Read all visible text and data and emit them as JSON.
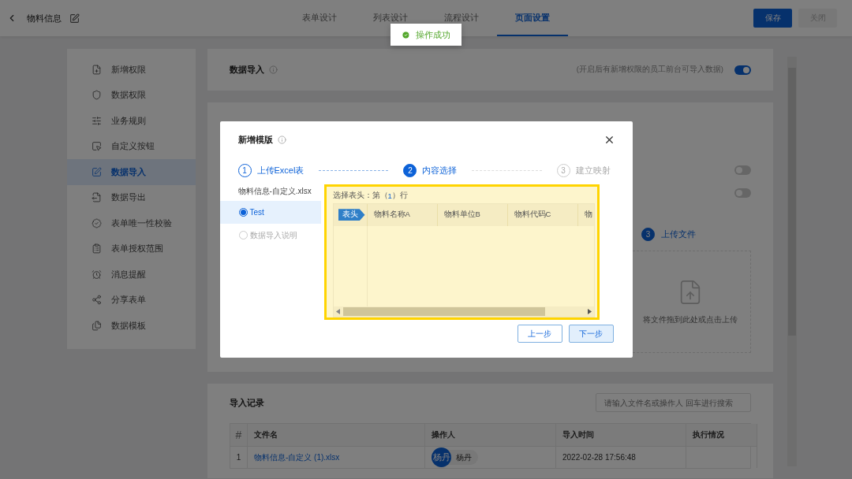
{
  "header": {
    "title": "物料信息",
    "tabs": [
      {
        "label": "表单设计",
        "selected": false
      },
      {
        "label": "列表设计",
        "selected": false
      },
      {
        "label": "流程设计",
        "selected": false
      },
      {
        "label": "页面设置",
        "selected": true
      }
    ],
    "buttons": [
      {
        "label": "保存",
        "kind": "primary"
      },
      {
        "label": "关闭",
        "kind": "disabled"
      }
    ]
  },
  "toast": {
    "text": "操作成功"
  },
  "sidebar": {
    "items": [
      {
        "label": "新增权限",
        "selected": false
      },
      {
        "label": "数据权限",
        "selected": false
      },
      {
        "label": "业务规则",
        "selected": false
      },
      {
        "label": "自定义按钮",
        "selected": false
      },
      {
        "label": "数据导入",
        "selected": true
      },
      {
        "label": "数据导出",
        "selected": false
      },
      {
        "label": "表单唯一性校验",
        "selected": false
      },
      {
        "label": "表单授权范围",
        "selected": false
      },
      {
        "label": "消息提醒",
        "selected": false
      },
      {
        "label": "分享表单",
        "selected": false
      },
      {
        "label": "数据模板",
        "selected": false
      }
    ]
  },
  "data_import": {
    "title": "数据导入",
    "hint": "(开启后有新增权限的员工前台可导入数据)",
    "on": true
  },
  "import_status": {
    "toggles": [
      {
        "on": false
      },
      {
        "on": false
      }
    ],
    "step": {
      "number": "3",
      "label": "上传文件"
    },
    "upload_hint": "将文件拖到此处或点击上传"
  },
  "records": {
    "title": "导入记录",
    "search": {
      "placeholder": "请输入文件名或操作人 回车进行搜索"
    },
    "columns": [
      "#",
      "文件名",
      "操作人",
      "导入时间",
      "执行情况"
    ],
    "rows": [
      {
        "index": "1",
        "file": "物料信息-自定义 (1).xlsx",
        "avatar": "杨丹",
        "operator": "杨丹",
        "time": "2022-02-28 17:56:48"
      }
    ]
  },
  "modal": {
    "title": "新增模版",
    "steps": [
      {
        "number": "1",
        "label": "上传Excel表",
        "completed": true,
        "selected": false
      },
      {
        "number": "2",
        "label": "内容选择",
        "completed": false,
        "selected": true
      },
      {
        "number": "3",
        "label": "建立映射",
        "completed": false,
        "selected": false
      }
    ],
    "file_name": "物料信息-自定义.xlsx",
    "sheets": [
      {
        "label": "Test",
        "selected": true
      },
      {
        "label": "数据导入说明",
        "selected": false
      }
    ],
    "header_row": {
      "label": "选择表头：第（",
      "value": "1",
      "suffix": "）行"
    },
    "preview": {
      "tag": "表头",
      "columns": [
        "物料名称A",
        "物料单位B",
        "物料代码C",
        "物"
      ]
    },
    "buttons": [
      {
        "label": "上一步",
        "kind": "default"
      },
      {
        "label": "下一步",
        "kind": "primary"
      }
    ]
  }
}
